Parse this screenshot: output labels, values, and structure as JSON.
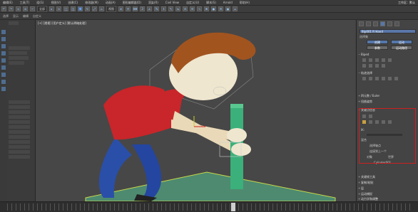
{
  "menubar": {
    "items": [
      "编辑(E)",
      "工具(T)",
      "组(G)",
      "视图(V)",
      "创建(C)",
      "修改器(M)",
      "动画(A)",
      "图形编辑器(D)",
      "渲染(R)",
      "Civil View",
      "自定义(U)",
      "脚本(S)",
      "Arnold",
      "帮助(H)"
    ],
    "workspace": "工作区：默认"
  },
  "toolbar": {
    "selection_filter": "全部",
    "view_mode": "视图"
  },
  "toolbar2": {
    "items": [
      "选择",
      "显示",
      "编辑",
      "自定义"
    ]
  },
  "viewport": {
    "label": "[+] [透视] [用户定义] [默认明暗处理]"
  },
  "cmdpanel": {
    "object_name": "Bip001 R Hand",
    "color_label": "选择集",
    "buttons": [
      "创建",
      "运动"
    ],
    "sub_buttons": [
      "参数",
      "运动路径"
    ],
    "sections": [
      {
        "label": "Biped",
        "open": true
      },
      {
        "label": "轨迹选择",
        "open": true
      },
      {
        "label": "四元数 / Euler",
        "open": false
      },
      {
        "label": "扭曲姿势",
        "open": false
      },
      {
        "label": "关键点信息",
        "open": true
      },
      {
        "label": "关键帧工具",
        "open": false
      },
      {
        "label": "复制/粘贴",
        "open": false
      },
      {
        "label": "层",
        "open": false
      },
      {
        "label": "运动捕捉",
        "open": false
      },
      {
        "label": "动力学和调整",
        "open": false
      }
    ],
    "key_info": {
      "ik_label": "IK:",
      "blend_label": "混合",
      "select_pivot_label": "选择轴点",
      "pivot_label": "轴点",
      "object_label": "对象",
      "joined_label": "连接到上一个",
      "world_label": "世界",
      "target_name": "Cylinder001"
    }
  }
}
